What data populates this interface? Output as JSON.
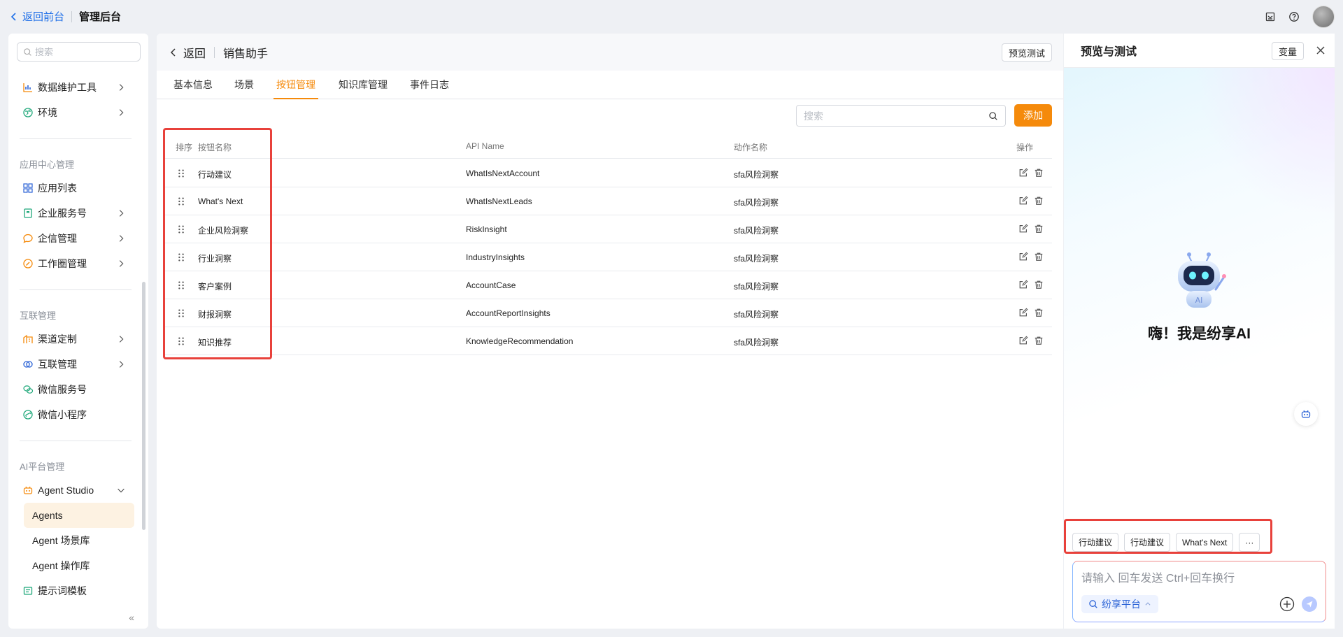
{
  "topbar": {
    "back_front": "返回前台",
    "admin_title": "管理后台"
  },
  "sidebar": {
    "search_placeholder": "搜索",
    "items_top": [
      {
        "label": "数据维护工具"
      },
      {
        "label": "环境"
      }
    ],
    "group_app": "应用中心管理",
    "items_app": [
      {
        "label": "应用列表"
      },
      {
        "label": "企业服务号"
      },
      {
        "label": "企信管理"
      },
      {
        "label": "工作圈管理"
      }
    ],
    "group_interconnect": "互联管理",
    "items_interconnect": [
      {
        "label": "渠道定制"
      },
      {
        "label": "互联管理"
      },
      {
        "label": "微信服务号"
      },
      {
        "label": "微信小程序"
      }
    ],
    "group_ai": "AI平台管理",
    "agent_studio": "Agent Studio",
    "items_ai_sub": [
      {
        "label": "Agents"
      },
      {
        "label": "Agent 场景库"
      },
      {
        "label": "Agent 操作库"
      }
    ],
    "prompt_template": "提示词模板"
  },
  "main": {
    "back": "返回",
    "title": "销售助手",
    "preview_btn": "预览测试",
    "tabs": [
      {
        "label": "基本信息"
      },
      {
        "label": "场景"
      },
      {
        "label": "按钮管理"
      },
      {
        "label": "知识库管理"
      },
      {
        "label": "事件日志"
      }
    ],
    "search_placeholder": "搜索",
    "add_btn": "添加",
    "columns": {
      "order": "排序",
      "name": "按钮名称",
      "api": "API Name",
      "action": "动作名称",
      "ops": "操作"
    },
    "rows": [
      {
        "name": "行动建议",
        "api": "WhatIsNextAccount",
        "action": "sfa风险洞察"
      },
      {
        "name": "What's Next",
        "api": "WhatIsNextLeads",
        "action": "sfa风险洞察"
      },
      {
        "name": "企业风险洞察",
        "api": "RiskInsight",
        "action": "sfa风险洞察"
      },
      {
        "name": "行业洞察",
        "api": "IndustryInsights",
        "action": "sfa风险洞察"
      },
      {
        "name": "客户案例",
        "api": "AccountCase",
        "action": "sfa风险洞察"
      },
      {
        "name": "财报洞察",
        "api": "AccountReportInsights",
        "action": "sfa风险洞察"
      },
      {
        "name": "知识推荐",
        "api": "KnowledgeRecommendation",
        "action": "sfa风险洞察"
      }
    ]
  },
  "panel": {
    "title": "预览与测试",
    "var_btn": "变量",
    "robot_badge": "AI",
    "greeting": "嗨！我是纷享AI",
    "chips": [
      {
        "label": "行动建议"
      },
      {
        "label": "行动建议"
      },
      {
        "label": "What's Next"
      }
    ],
    "more": "···",
    "input_placeholder": "请输入 回车发送 Ctrl+回车换行",
    "platform": "纷享平台"
  },
  "colors": {
    "accent": "#f58a0b",
    "link": "#1f6fe8",
    "highlight": "#e8413b"
  }
}
